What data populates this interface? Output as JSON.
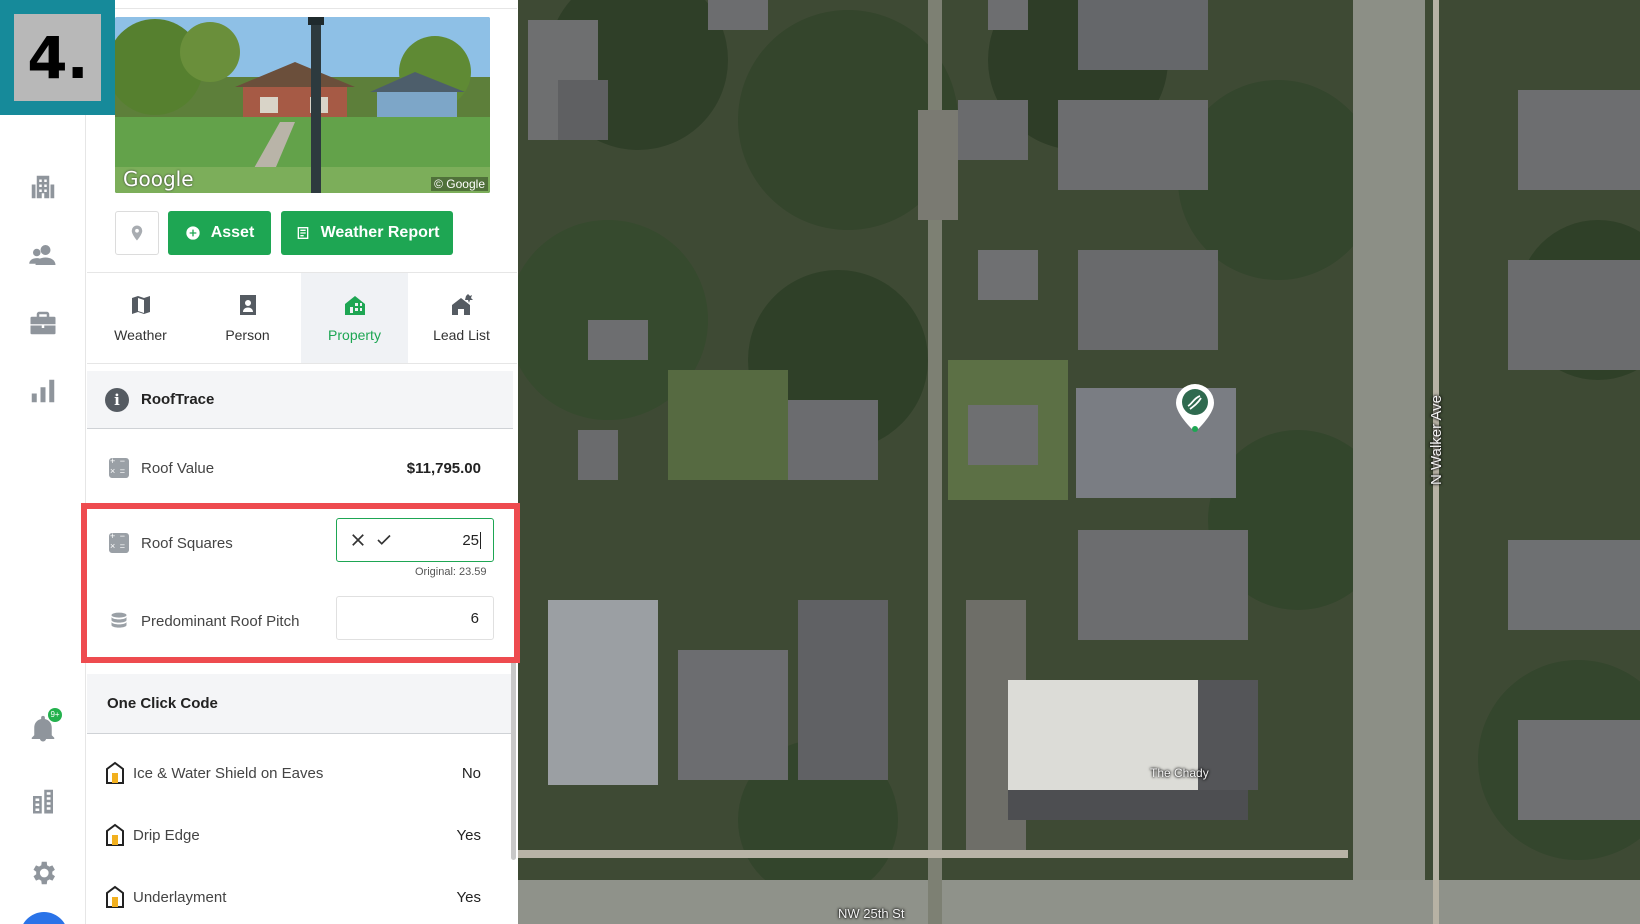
{
  "step_badge": "4.",
  "street_view": {
    "watermark": "Google",
    "copyright": "© Google"
  },
  "actions": {
    "asset_label": "Asset",
    "weather_report_label": "Weather Report"
  },
  "tabs": [
    {
      "label": "Weather",
      "icon": "map-icon",
      "active": false
    },
    {
      "label": "Person",
      "icon": "person-badge-icon",
      "active": false
    },
    {
      "label": "Property",
      "icon": "property-icon",
      "active": true
    },
    {
      "label": "Lead List",
      "icon": "lead-list-icon",
      "active": false
    }
  ],
  "rooftrace": {
    "title": "RoofTrace",
    "roof_value_label": "Roof Value",
    "roof_value": "$11,795.00",
    "roof_squares_label": "Roof Squares",
    "roof_squares_input": "25",
    "roof_squares_original": "Original: 23.59",
    "pitch_label": "Predominant Roof Pitch",
    "pitch_value": "6"
  },
  "one_click_code": {
    "title": "One Click Code",
    "items": [
      {
        "label": "Ice & Water Shield on Eaves",
        "value": "No"
      },
      {
        "label": "Drip Edge",
        "value": "Yes"
      },
      {
        "label": "Underlayment",
        "value": "Yes"
      }
    ]
  },
  "notifications": {
    "badge": "9+"
  },
  "map": {
    "street_vertical": "N Walker Ave",
    "street_horizontal": "NW 25th St",
    "poi": "The Chady"
  },
  "colors": {
    "accent_green": "#1ea653",
    "highlight_red": "#ee4b4f",
    "badge_teal": "#168a9a"
  }
}
